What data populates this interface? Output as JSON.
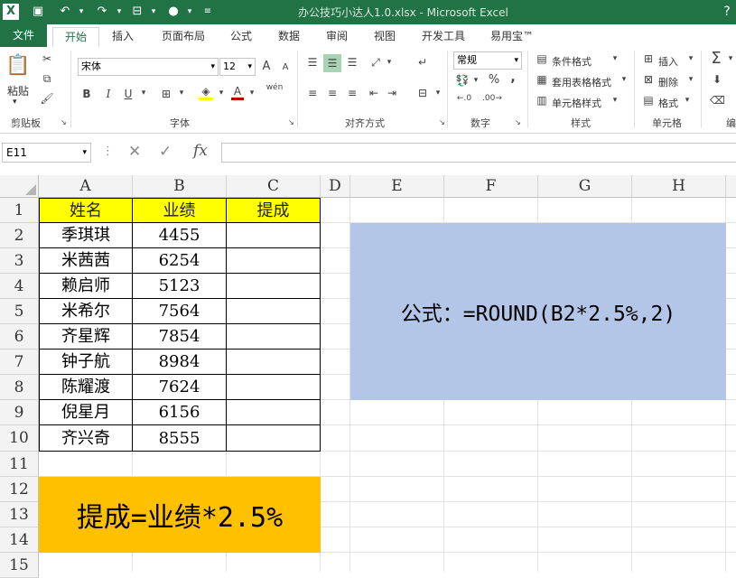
{
  "title_bar": {
    "title": "办公技巧小达人1.0.xlsx - Microsoft Excel",
    "app_icon": "X"
  },
  "tabs": [
    "文件",
    "开始",
    "插入",
    "页面布局",
    "公式",
    "数据",
    "审阅",
    "视图",
    "开发工具",
    "易用宝™"
  ],
  "ribbon": {
    "clipboard": {
      "paste": "粘贴",
      "label": "剪贴板"
    },
    "font": {
      "name": "宋体",
      "size": "12",
      "label": "字体",
      "bold": "B",
      "italic": "I",
      "underline": "U",
      "grow": "A",
      "shrink": "A",
      "font_color": "A",
      "phonetic": "wén"
    },
    "alignment": {
      "label": "对齐方式"
    },
    "number": {
      "format": "常规",
      "label": "数字",
      "percent": "%",
      "comma": ","
    },
    "styles": {
      "cond_format": "条件格式",
      "table_format": "套用表格格式",
      "cell_styles": "单元格样式",
      "label": "样式"
    },
    "cells": {
      "insert": "插入",
      "delete": "删除",
      "format": "格式",
      "label": "单元格"
    },
    "editing": {
      "sum": "Σ",
      "label": "编"
    }
  },
  "formula_bar": {
    "name_box": "E11",
    "fx": "fx",
    "content": ""
  },
  "columns": [
    "A",
    "B",
    "C",
    "D",
    "E",
    "F",
    "G",
    "H"
  ],
  "rows": [
    "1",
    "2",
    "3",
    "4",
    "5",
    "6",
    "7",
    "8",
    "9",
    "10",
    "11",
    "12",
    "13",
    "14",
    "15"
  ],
  "table": {
    "headers": [
      "姓名",
      "业绩",
      "提成"
    ],
    "rows": [
      [
        "季琪琪",
        "4455",
        ""
      ],
      [
        "米茜茜",
        "6254",
        ""
      ],
      [
        "赖启师",
        "5123",
        ""
      ],
      [
        "米希尔",
        "7564",
        ""
      ],
      [
        "齐星辉",
        "7854",
        ""
      ],
      [
        "钟子航",
        "8984",
        ""
      ],
      [
        "陈耀渡",
        "7624",
        ""
      ],
      [
        "倪星月",
        "6156",
        ""
      ],
      [
        "齐兴奇",
        "8555",
        ""
      ]
    ]
  },
  "notes": {
    "formula": "公式：=ROUND(B2*2.5%,2)",
    "rule": "提成=业绩*2.5%"
  },
  "colors": {
    "excel_green": "#217346",
    "header_yellow": "#ffff00",
    "blue_box": "#b4c6e7",
    "orange_box": "#ffc000"
  }
}
